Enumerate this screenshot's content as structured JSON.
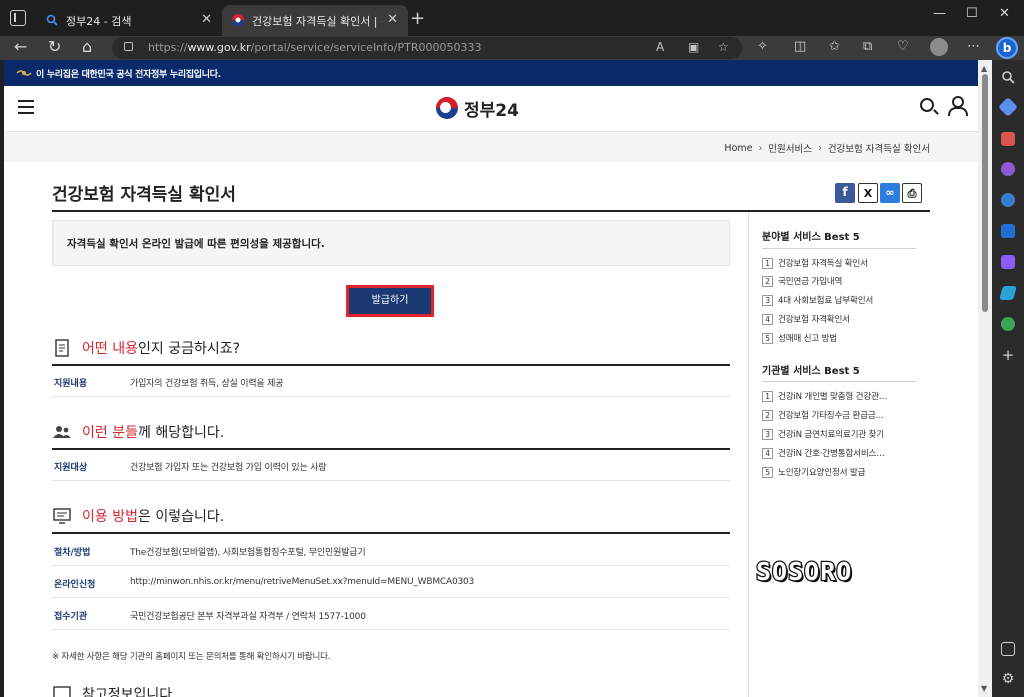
{
  "browser": {
    "tabs": [
      {
        "label": "정부24 - 검색"
      },
      {
        "label": "건강보험 자격득실 확인서 | 정부"
      }
    ],
    "url_prefix": "https://",
    "url_host": "www.gov.kr",
    "url_path": "/portal/service/serviceInfo/PTR000050333",
    "bing_label": "b"
  },
  "banner": {
    "text": "이 누리집은 대한민국 공식 전자정부 누리집입니다."
  },
  "header": {
    "logo_text": "정부24"
  },
  "breadcrumb": [
    "Home",
    "민원서비스",
    "건강보험 자격득실 확인서"
  ],
  "page": {
    "title": "건강보험 자격득실 확인서",
    "summary": "자격득실 확인서 온라인 발급에 따른 편의성을 제공합니다.",
    "apply_label": "발급하기"
  },
  "share": {
    "facebook": "f",
    "x": "X",
    "link": "∞",
    "print": "⎙"
  },
  "sections": [
    {
      "highlight": "어떤 내용",
      "suffix": "인지 궁금하시죠?",
      "rows": [
        {
          "key": "지원내용",
          "value": "가입자의 건강보험 취득, 상실 이력을 제공"
        }
      ]
    },
    {
      "highlight": "이런 분들",
      "suffix": "께 해당합니다.",
      "rows": [
        {
          "key": "지원대상",
          "value": "건강보험 가입자 또는 건강보험 가입 이력이 있는 사람"
        }
      ]
    },
    {
      "highlight": "이용 방법",
      "suffix": "은 이렇습니다.",
      "rows": [
        {
          "key": "절차/방법",
          "value": "The건강보험(모바일앱), 사회보험통합징수포털, 무인민원발급기"
        },
        {
          "key": "온라인신청",
          "value": "http://minwon.nhis.or.kr/menu/retriveMenuSet.xx?menuId=MENU_WBMCA0303"
        },
        {
          "key": "접수기관",
          "value": "국민건강보험공단 본부 자격부과실 자격부 / 연락처 1577-1000"
        }
      ]
    }
  ],
  "note": "※ 자세한 사항은 해당 기관의 홈페이지 또는 문의처를 통해 확인하시기 바랍니다.",
  "peek_heading": "참고정보입니다",
  "sidebar": {
    "field_title": "분야별 서비스 Best 5",
    "field_items": [
      {
        "num": "1",
        "label": "건강보험 자격득실 확인서"
      },
      {
        "num": "2",
        "label": "국민연금 가입내역"
      },
      {
        "num": "3",
        "label": "4대 사회보험료 납부확인서"
      },
      {
        "num": "4",
        "label": "건강보험 자격확인서"
      },
      {
        "num": "5",
        "label": "성매매 신고 방법"
      }
    ],
    "agency_title": "기관별 서비스 Best 5",
    "agency_items": [
      {
        "num": "1",
        "label": "건강iN 개인별 맞춤형 건강관…"
      },
      {
        "num": "2",
        "label": "건강보험 기타징수금 환급금…"
      },
      {
        "num": "3",
        "label": "건강iN 금연치료의료기관 찾기"
      },
      {
        "num": "4",
        "label": "건강iN 간호·간병통합서비스…"
      },
      {
        "num": "5",
        "label": "노인장기요양인정서 발급"
      }
    ]
  },
  "watermark": "SOSORO",
  "colors": {
    "gov_navy": "#0a2a6b",
    "button_navy": "#1b3a73",
    "highlight_red": "#d6262f",
    "button_border_red": "#e0252c",
    "facebook_blue": "#3b5998",
    "link_blue": "#2d7de0"
  }
}
